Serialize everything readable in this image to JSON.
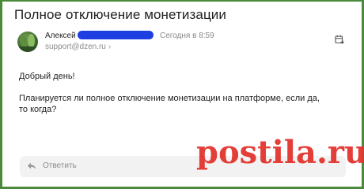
{
  "message": {
    "subject": "Полное отключение монетизации",
    "sender": {
      "name": "Алексей",
      "email": "support@dzen.ru",
      "time": "Сегодня в 8:59"
    },
    "body": {
      "greeting": "Добрый день!",
      "paragraph": "Планируется ли полное отключение монетизации на платформе, если да, то когда?"
    }
  },
  "reply": {
    "label": "Ответить"
  },
  "watermark": "postila.ru",
  "icons": {
    "calendar": "calendar-add-icon",
    "reply": "reply-arrow-icon",
    "chevron": "chevron-right-icon"
  },
  "colors": {
    "frame": "#4a8a3a",
    "redaction": "#1d3fe2",
    "watermark": "#e3342f"
  }
}
